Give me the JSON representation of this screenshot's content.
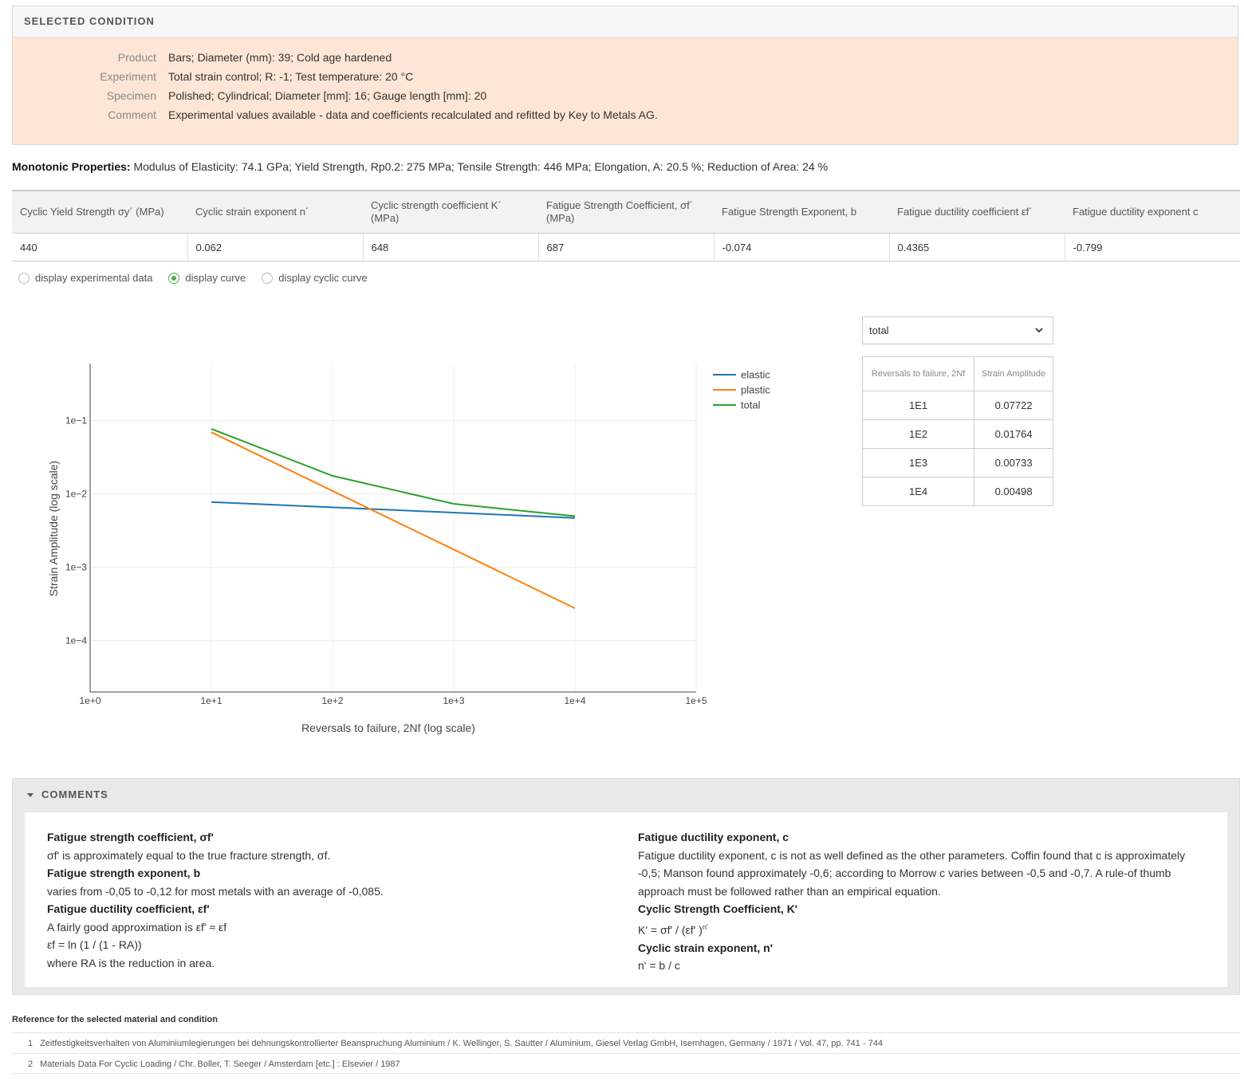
{
  "selected": {
    "header": "SELECTED CONDITION",
    "rows": [
      {
        "label": "Product",
        "value": "Bars; Diameter (mm): 39; Cold age hardened"
      },
      {
        "label": "Experiment",
        "value": "Total strain control; R: -1; Test temperature: 20 °C"
      },
      {
        "label": "Specimen",
        "value": "Polished; Cylindrical; Diameter [mm]: 16; Gauge length [mm]: 20"
      },
      {
        "label": "Comment",
        "value": "Experimental values available - data and coefficients recalculated and refitted by Key to Metals AG."
      }
    ]
  },
  "monotonic": {
    "label": "Monotonic Properties:",
    "value": "Modulus of Elasticity: 74.1 GPa; Yield Strength, Rp0.2: 275 MPa; Tensile Strength: 446 MPa; Elongation, A: 20.5 %; Reduction of Area: 24 %"
  },
  "props_table": {
    "headers": [
      "Cyclic Yield Strength σy´ (MPa)",
      "Cyclic strain exponent n´",
      "Cyclic strength coefficient K´ (MPa)",
      "Fatigue Strength Coefficient, σf´ (MPa)",
      "Fatigue Strength Exponent, b",
      "Fatigue ductility coefficient εf´",
      "Fatigue ductility exponent c"
    ],
    "values": [
      "440",
      "0.062",
      "648",
      "687",
      "-0.074",
      "0.4365",
      "-0.799"
    ]
  },
  "radios": [
    {
      "label": "display experimental data",
      "selected": false
    },
    {
      "label": "display curve",
      "selected": true
    },
    {
      "label": "display cyclic curve",
      "selected": false
    }
  ],
  "dropdown": {
    "value": "total"
  },
  "summary_table": {
    "headers": [
      "Reversals to failure, 2Nf",
      "Strain Amplitude"
    ],
    "rows": [
      [
        "1E1",
        "0.07722"
      ],
      [
        "1E2",
        "0.01764"
      ],
      [
        "1E3",
        "0.00733"
      ],
      [
        "1E4",
        "0.00498"
      ]
    ]
  },
  "chart_data": {
    "type": "line",
    "xlabel": "Reversals to failure, 2Nf (log scale)",
    "ylabel": "Strain Amplitude (log scale)",
    "x_scale": "log",
    "y_scale": "log",
    "xlim": [
      1,
      100000
    ],
    "ylim": [
      2e-05,
      0.6
    ],
    "x_ticks": [
      1,
      10,
      100,
      1000,
      10000,
      100000
    ],
    "x_tick_labels": [
      "1e+0",
      "1e+1",
      "1e+2",
      "1e+3",
      "1e+4",
      "1e+5"
    ],
    "y_ticks": [
      0.0001,
      0.001,
      0.01,
      0.1
    ],
    "y_tick_labels": [
      "1e−4",
      "1e−3",
      "1e−2",
      "1e−1"
    ],
    "grid": true,
    "legend_position": "top-right",
    "x": [
      10,
      100,
      1000,
      10000
    ],
    "series": [
      {
        "name": "elastic",
        "color": "#1f77b4",
        "values": [
          0.00778,
          0.00658,
          0.00557,
          0.00471
        ]
      },
      {
        "name": "plastic",
        "color": "#ff7f0e",
        "values": [
          0.0694,
          0.01101,
          0.00175,
          0.000277
        ]
      },
      {
        "name": "total",
        "color": "#2ca02c",
        "values": [
          0.07722,
          0.01764,
          0.00733,
          0.00498
        ]
      }
    ]
  },
  "comments": {
    "header": "COMMENTS",
    "left": [
      {
        "heading": "Fatigue strength coefficient, σf'",
        "lines": [
          "σf' is approximately equal to the true fracture strength, σf."
        ]
      },
      {
        "heading": "Fatigue strength exponent, b",
        "lines": [
          "varies from -0,05 to -0,12 for most metals with an average of -0,085."
        ]
      },
      {
        "heading": "Fatigue ductility coefficient, εf'",
        "lines": [
          "A fairly good approximation is εf' ≈ εf",
          "εf = ln (1 / (1 - RA))",
          "where RA is the reduction in area."
        ]
      }
    ],
    "right": [
      {
        "heading": "Fatigue ductility exponent, c",
        "lines": [
          "Fatigue ductility exponent, c is not as well defined as the other parameters. Coffin found that c is approximately -0,5; Manson found approximately -0,6; according to Morrow c varies between -0,5 and -0,7. A rule-of thumb approach must be followed rather than an empirical equation."
        ]
      },
      {
        "heading": "Cyclic Strength Coefficient, K'",
        "formula": "K' = σf' / (εf' )",
        "formula_sup": "n'"
      },
      {
        "heading": "Cyclic strain exponent, n'",
        "lines": [
          "n' = b / c"
        ]
      }
    ]
  },
  "references": {
    "title": "Reference for the selected material and condition",
    "items": [
      {
        "num": "1",
        "text": "Zeitfestigkeitsverhalten von Aluminiumlegierungen bei dehnungskontrollierter Beanspruchung Aluminium / K. Wellinger, S. Sautter / Aluminium, Giesel Verlag GmbH, Isernhagen, Germany / 1971 / Vol. 47, pp. 741 - 744"
      },
      {
        "num": "2",
        "text": "Materials Data For Cyclic Loading / Chr. Boller, T. Seeger / Amsterdam [etc.] : Elsevier / 1987"
      }
    ]
  }
}
